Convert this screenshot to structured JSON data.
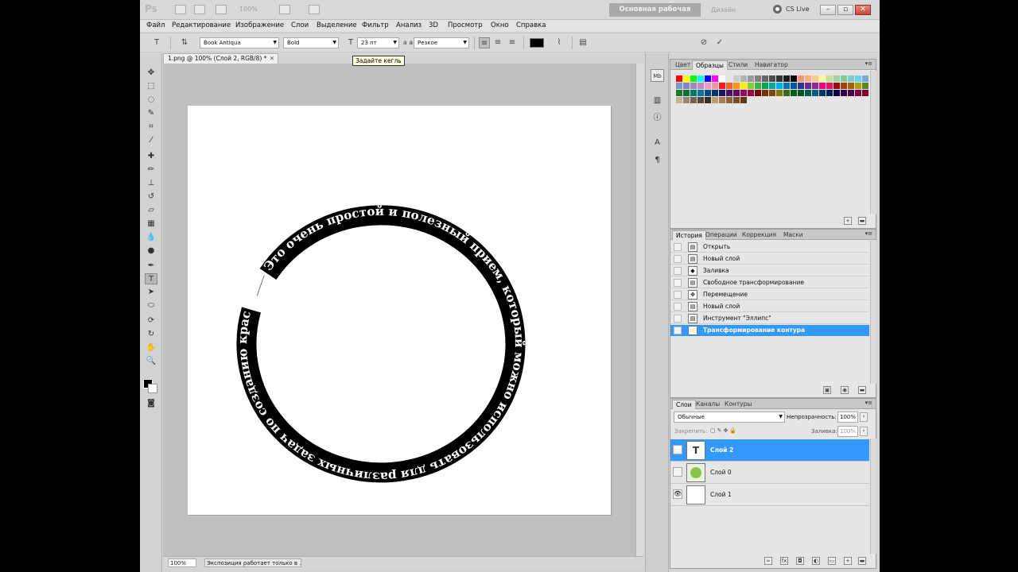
{
  "app": {
    "logo": "Ps",
    "zoom": "100%",
    "workspace_button": "Основная рабочая среда",
    "design_link": "Дизайн",
    "cs_live": "CS Live",
    "window_minimize": "–",
    "window_restore": "▫",
    "window_close": "✕"
  },
  "menu": [
    "Файл",
    "Редактирование",
    "Изображение",
    "Слои",
    "Выделение",
    "Фильтр",
    "Анализ",
    "3D",
    "Просмотр",
    "Окно",
    "Справка"
  ],
  "options": {
    "font_family": "Book Antiqua",
    "font_style": "Bold",
    "font_size": "23 пт",
    "aa_label": "a a",
    "antialias": "Резкое",
    "tooltip": "Задайте кегль"
  },
  "document": {
    "tab_title": "1.png @ 100% (Слой 2, RGB/8) *",
    "circle_text": "Это очень простой и полезный прием, который можно использовать для различных задач по созданию красивого",
    "status_zoom": "100%",
    "status_info": "Экспозиция работает только в ..."
  },
  "swatches_panel": {
    "tabs": [
      "Цвет",
      "Образцы",
      "Стили",
      "Навигатор"
    ],
    "active_tab": 1,
    "colors": [
      "#ff0000",
      "#ffff00",
      "#00ff00",
      "#00ffff",
      "#0000ff",
      "#ff00ff",
      "#ffffff",
      "#e6e6e6",
      "#cccccc",
      "#b3b3b3",
      "#999999",
      "#808080",
      "#666666",
      "#4d4d4d",
      "#333333",
      "#1a1a1a",
      "#000000",
      "#f7977a",
      "#f9ad81",
      "#fdc68a",
      "#fff79a",
      "#c4df9b",
      "#a2d39c",
      "#82ca9d",
      "#7bcdc8",
      "#6ecff6",
      "#7ea7d8",
      "#8493ca",
      "#8882be",
      "#a187be",
      "#bc8dbf",
      "#f49ac2",
      "#f6989d",
      "#ed1c24",
      "#f26522",
      "#f7941d",
      "#fff200",
      "#8dc63f",
      "#39b54a",
      "#00a651",
      "#00a99d",
      "#00aeef",
      "#0072bc",
      "#0054a6",
      "#2e3192",
      "#662d91",
      "#92278f",
      "#ec008c",
      "#ed145b",
      "#9e0b0f",
      "#a0410d",
      "#a36209",
      "#aba000",
      "#598527",
      "#1a7b30",
      "#007236",
      "#00746b",
      "#0076a3",
      "#004b80",
      "#003471",
      "#1b1464",
      "#440e62",
      "#630460",
      "#9e005d",
      "#9e0039",
      "#790000",
      "#7b2e00",
      "#7d4900",
      "#827b00",
      "#406618",
      "#005e20",
      "#005826",
      "#005952",
      "#005b7f",
      "#003663",
      "#002157",
      "#0d004c",
      "#32004b",
      "#4b0049",
      "#7b0046",
      "#7a0026",
      "#c7b299",
      "#998675",
      "#736357",
      "#534741",
      "#37302a",
      "#c69c6d",
      "#a67c52",
      "#8c6239",
      "#754c24",
      "#603913"
    ]
  },
  "history_panel": {
    "tabs": [
      "История",
      "Операции",
      "Коррекция",
      "Маски"
    ],
    "active_tab": 0,
    "items": [
      "Открыть",
      "Новый слой",
      "Заливка",
      "Свободное трансформирование",
      "Перемещение",
      "Новый слой",
      "Инструмент \"Эллипс\"",
      "Трансформирование контура"
    ],
    "selected_index": 7
  },
  "layers_panel": {
    "tabs": [
      "Слои",
      "Каналы",
      "Контуры"
    ],
    "active_tab": 0,
    "blend_mode": "Обычные",
    "opacity_label": "Непрозрачность:",
    "opacity_value": "100%",
    "lock_label": "Закрепить:",
    "fill_label": "Заливка:",
    "fill_value": "100%",
    "layers": [
      {
        "name": "Слой 2",
        "visible": true,
        "selected": true,
        "thumb": "T"
      },
      {
        "name": "Слой 0",
        "visible": false,
        "selected": false,
        "thumb": "img"
      },
      {
        "name": "Слой 1",
        "visible": true,
        "selected": false,
        "thumb": "blank"
      }
    ]
  }
}
